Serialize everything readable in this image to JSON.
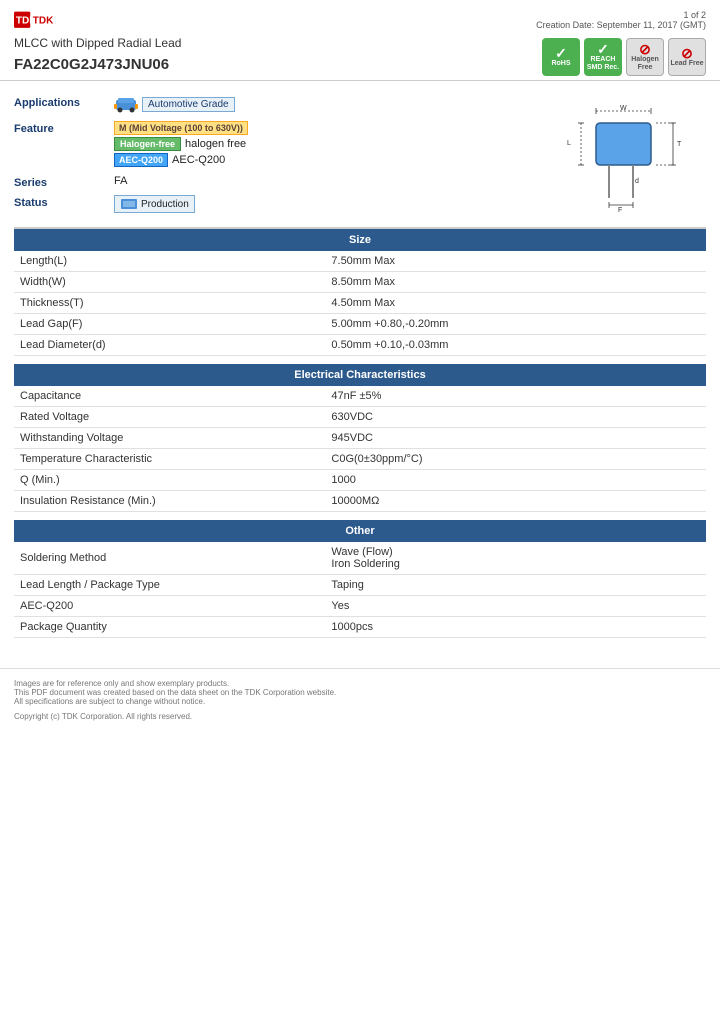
{
  "header": {
    "logo_text": "TDK",
    "product_type": "MLCC with Dipped Radial Lead",
    "part_number": "FA22C0G2J473JNU06",
    "page_info": "1 of 2",
    "creation_date": "Creation Date: September 11, 2017 (GMT)"
  },
  "badges": [
    {
      "id": "rohs",
      "label": "RoHS",
      "color": "green"
    },
    {
      "id": "reach",
      "label": "REACH\nSMD Rec.",
      "color": "green"
    },
    {
      "id": "halogen",
      "label": "Halogen\nFree",
      "color": "gray"
    },
    {
      "id": "lead",
      "label": "Lead\nFree",
      "color": "gray"
    }
  ],
  "attributes": {
    "applications_label": "Applications",
    "applications_tag": "Automotive Grade",
    "feature_label": "Feature",
    "feature_mv_tag": "M (Mid Voltage (100 to 630V))",
    "feature_hf_tag": "Halogen-free",
    "feature_aec_tag": "AEC-Q200",
    "feature_aec_text": "AEC-Q200",
    "series_label": "Series",
    "series_value": "FA",
    "status_label": "Status",
    "status_value": "Production"
  },
  "size": {
    "section_title": "Size",
    "rows": [
      {
        "label": "Length(L)",
        "value": "7.50mm Max"
      },
      {
        "label": "Width(W)",
        "value": "8.50mm Max"
      },
      {
        "label": "Thickness(T)",
        "value": "4.50mm Max"
      },
      {
        "label": "Lead Gap(F)",
        "value": "5.00mm +0.80,-0.20mm"
      },
      {
        "label": "Lead Diameter(d)",
        "value": "0.50mm +0.10,-0.03mm"
      }
    ]
  },
  "electrical": {
    "section_title": "Electrical Characteristics",
    "rows": [
      {
        "label": "Capacitance",
        "value": "47nF ±5%"
      },
      {
        "label": "Rated Voltage",
        "value": "630VDC"
      },
      {
        "label": "Withstanding Voltage",
        "value": "945VDC"
      },
      {
        "label": "Temperature Characteristic",
        "value": "C0G(0±30ppm/°C)"
      },
      {
        "label": "Q (Min.)",
        "value": "1000"
      },
      {
        "label": "Insulation Resistance (Min.)",
        "value": "10000MΩ"
      }
    ]
  },
  "other": {
    "section_title": "Other",
    "rows": [
      {
        "label": "Soldering Method",
        "value": "Wave (Flow)\nIron Soldering"
      },
      {
        "label": "Lead Length / Package Type",
        "value": "Taping"
      },
      {
        "label": "AEC-Q200",
        "value": "Yes"
      },
      {
        "label": "Package Quantity",
        "value": "1000pcs"
      }
    ]
  },
  "footer": {
    "notes": "Images are for reference only and show exemplary products.\nThis PDF document was created based on the data sheet on the TDK Corporation website.\nAll specifications are subject to change without notice.",
    "copyright": "Copyright (c) TDK Corporation. All rights reserved."
  }
}
